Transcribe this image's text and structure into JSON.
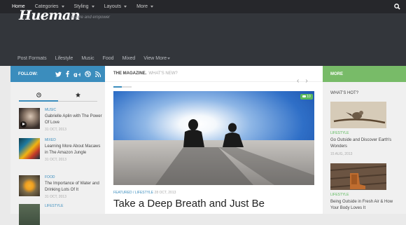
{
  "topnav": {
    "items": [
      {
        "label": "Home"
      },
      {
        "label": "Categories"
      },
      {
        "label": "Styling"
      },
      {
        "label": "Layouts"
      },
      {
        "label": "More"
      }
    ],
    "search_icon": "search-icon"
  },
  "header": {
    "logo": "Hueman",
    "tagline": "Inspire and empower"
  },
  "mainnav": {
    "items": [
      {
        "label": "Post Formats"
      },
      {
        "label": "Lifestyle"
      },
      {
        "label": "Music"
      },
      {
        "label": "Food"
      },
      {
        "label": "Mixed"
      },
      {
        "label": "View More"
      }
    ]
  },
  "left": {
    "follow_label": "FOLLOW:",
    "social_icons": [
      "twitter-icon",
      "facebook-icon",
      "google-plus-icon",
      "dribbble-icon",
      "rss-icon"
    ],
    "tab_icons": [
      "clock-icon",
      "star-icon"
    ],
    "items": [
      {
        "category": "MUSIC",
        "title": "Gabrielle Aplin with The Power Of Love",
        "date": "31 OCT, 2013"
      },
      {
        "category": "MIXED",
        "title": "Learning More About Macaws in The Amazon Jungle",
        "date": "31 OCT, 2013"
      },
      {
        "category": "FOOD",
        "title": "The Importance of Water and Drinking Lots Of It",
        "date": "31 OCT, 2013"
      },
      {
        "category": "LIFESTYLE",
        "title": "",
        "date": ""
      }
    ]
  },
  "main": {
    "heading": "THE MAGAZINE.",
    "subheading": "WHAT'S NEW?",
    "comment_count": "10",
    "post": {
      "category": "FEATURED / LIFESTYLE",
      "date": "28 OCT, 2013",
      "title": "Take a Deep Breath and Just Be"
    }
  },
  "right": {
    "more_label": "MORE",
    "hot_label": "WHAT'S HOT?",
    "items": [
      {
        "category": "LIFESTYLE",
        "title": "Go Outside and Discover Earth's Wonders",
        "date": "15 AUG, 2013"
      },
      {
        "category": "LIFESTYLE",
        "title": "Being Outside in Fresh Air & How Your Body Loves It",
        "date": ""
      }
    ]
  },
  "colors": {
    "blue_accent": "#3b8dbd",
    "green_accent": "#78bb68",
    "dark_nav": "#26272b",
    "header_bg": "#33363b"
  }
}
